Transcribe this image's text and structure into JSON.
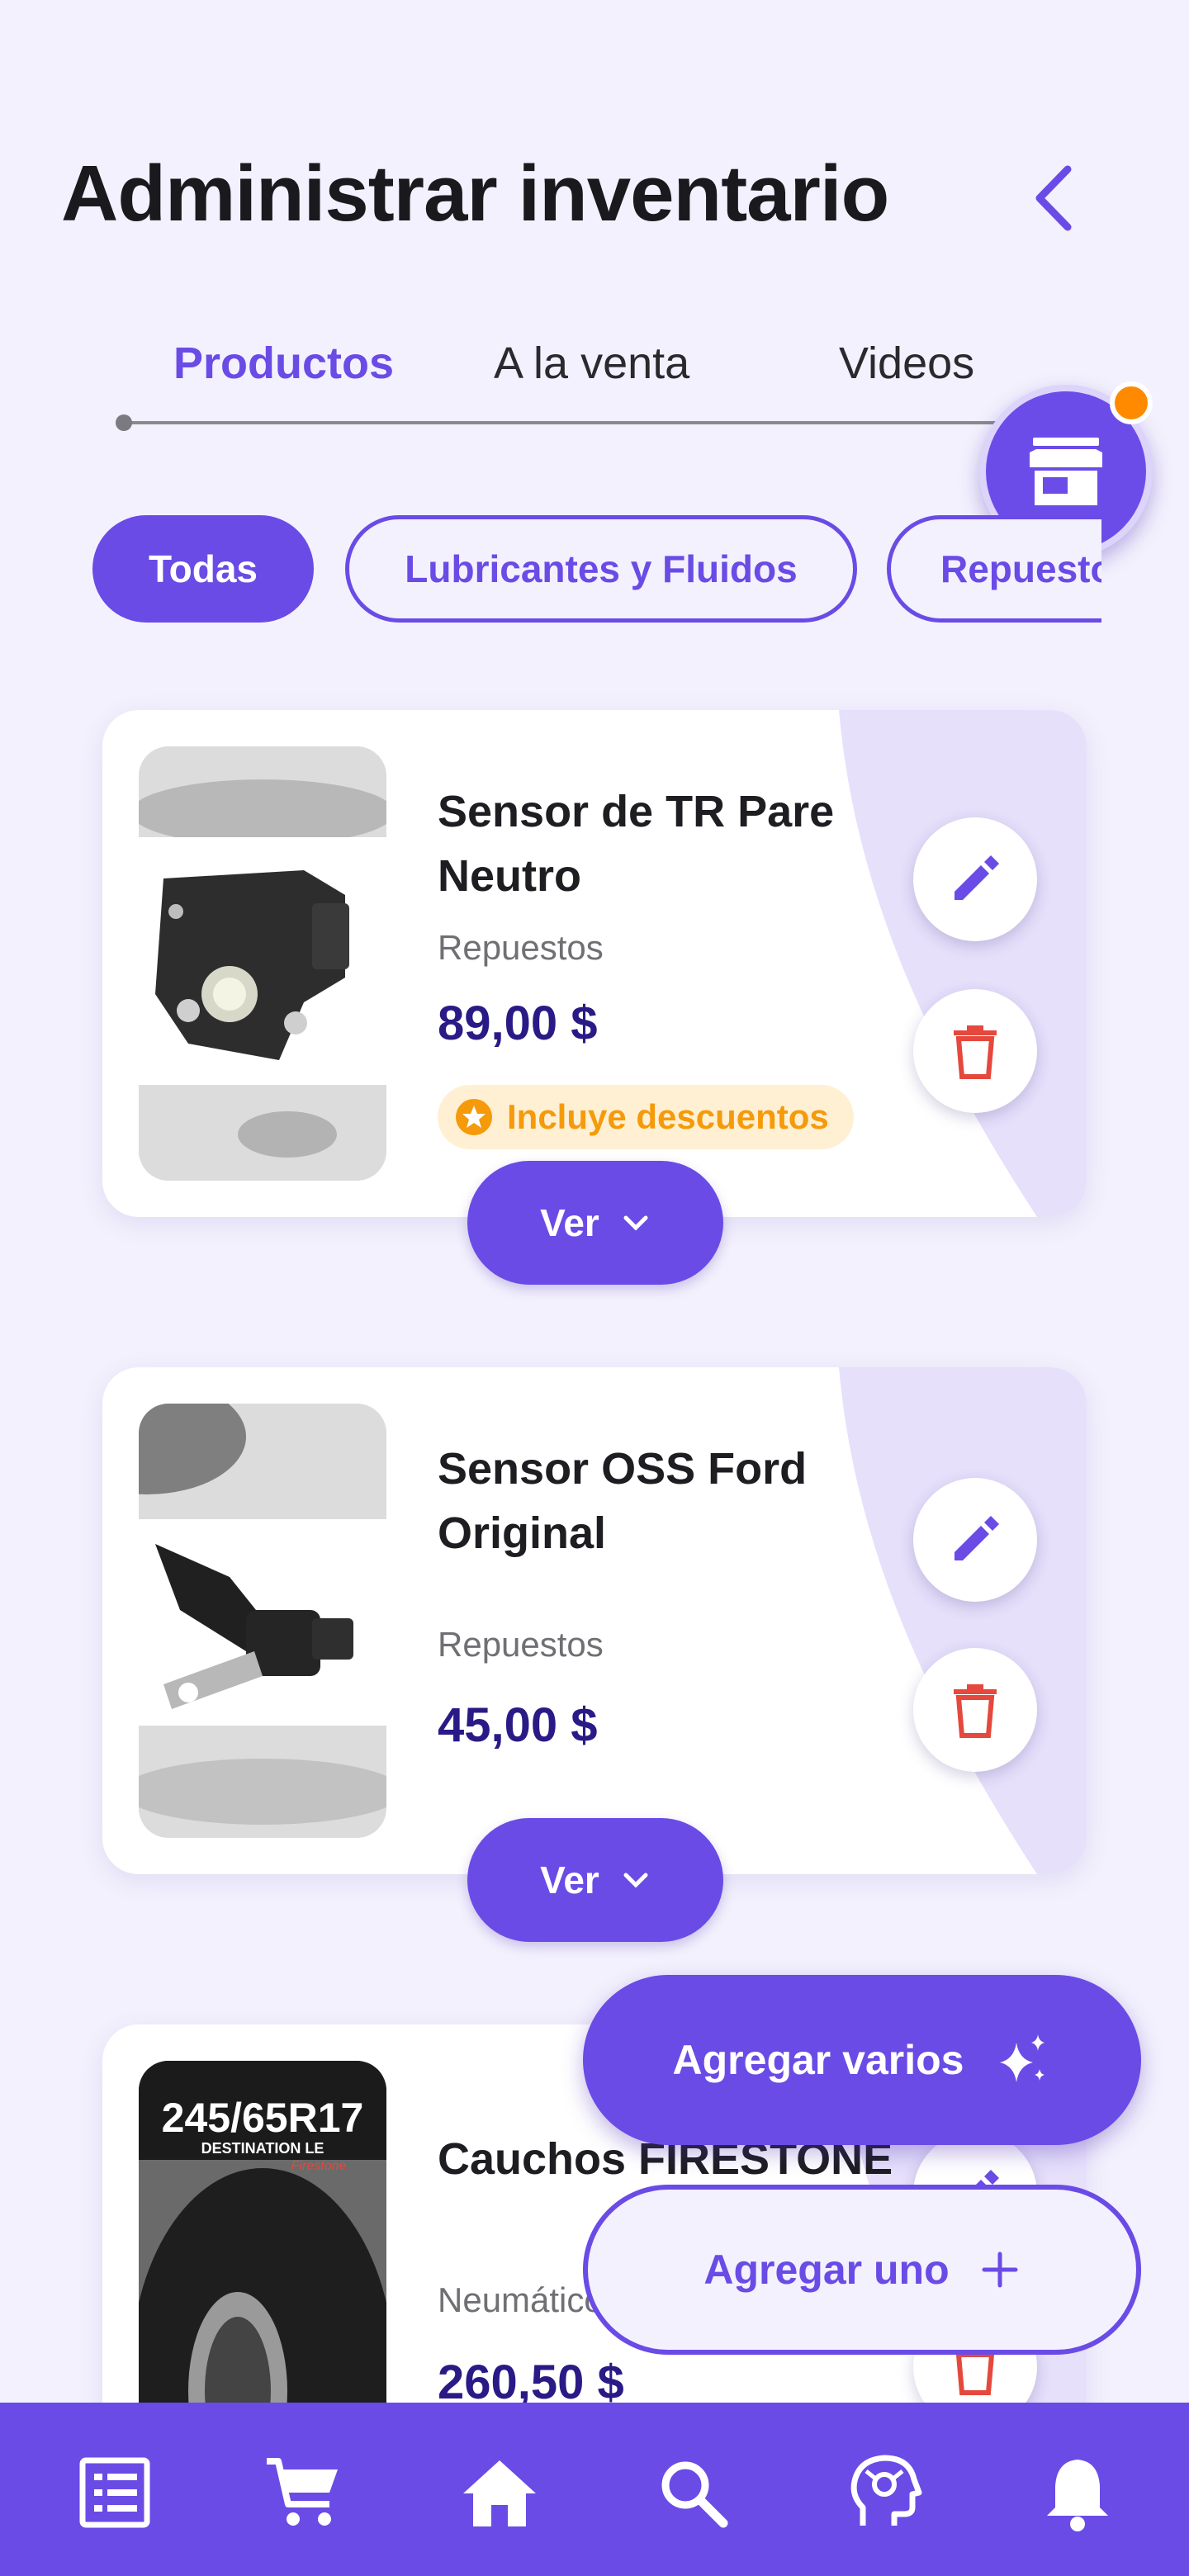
{
  "header": {
    "title": "Administrar inventario"
  },
  "tabs": [
    {
      "label": "Productos",
      "active": true
    },
    {
      "label": "A la venta",
      "active": false
    },
    {
      "label": "Videos",
      "active": false
    }
  ],
  "chips": [
    {
      "label": "Todas",
      "active": true
    },
    {
      "label": "Lubricantes y Fluidos",
      "active": false
    },
    {
      "label": "Repuestos",
      "active": false
    }
  ],
  "products": [
    {
      "name": "Sensor de TR Pare Neutro",
      "category": "Repuestos",
      "price": "89,00 $",
      "badge": "Incluye descuentos",
      "view_label": "Ver"
    },
    {
      "name": "Sensor OSS Ford Original",
      "category": "Repuestos",
      "price": "45,00 $",
      "view_label": "Ver"
    },
    {
      "name": "Cauchos FIRESTONE",
      "category": "Neumáticos",
      "price": "260,50 $",
      "tire_size": "245/65R17",
      "tire_model": "DESTINATION LE",
      "tire_brand": "Firestone"
    }
  ],
  "actions": {
    "add_many": "Agregar varios",
    "add_one": "Agregar uno"
  },
  "bottom_nav": [
    "list-icon",
    "cart-icon",
    "home-icon",
    "search-icon",
    "support-icon",
    "bell-icon"
  ],
  "colors": {
    "primary": "#6a4be6",
    "price": "#2a1a86",
    "delete": "#e5483c",
    "badge": "#f59a0a",
    "background": "#f3f1fd"
  }
}
